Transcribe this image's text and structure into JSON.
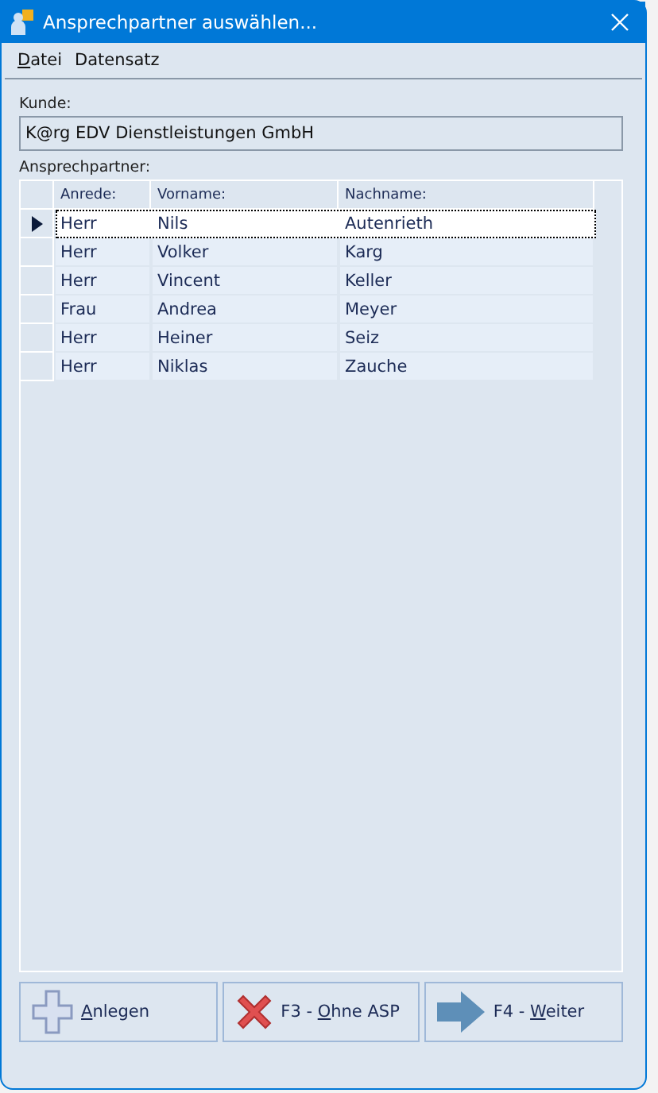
{
  "window": {
    "title": "Ansprechpartner auswählen..."
  },
  "menu": [
    {
      "key": "D",
      "rest": "atei"
    },
    {
      "rest": "Datensatz"
    }
  ],
  "customer": {
    "label": "Kunde:",
    "value": "K@rg EDV Dienstleistungen GmbH"
  },
  "contacts": {
    "label": "Ansprechpartner:",
    "columns": [
      "Anrede:",
      "Vorname:",
      "Nachname:"
    ],
    "rows": [
      {
        "cells": [
          "Herr",
          "Nils",
          "Autenrieth"
        ],
        "selected": true
      },
      {
        "cells": [
          "Herr",
          "Volker",
          "Karg"
        ],
        "selected": false
      },
      {
        "cells": [
          "Herr",
          "Vincent",
          "Keller"
        ],
        "selected": false
      },
      {
        "cells": [
          "Frau",
          "Andrea",
          "Meyer"
        ],
        "selected": false
      },
      {
        "cells": [
          "Herr",
          "Heiner",
          "Seiz"
        ],
        "selected": false
      },
      {
        "cells": [
          "Herr",
          "Niklas",
          "Zauche"
        ],
        "selected": false
      }
    ]
  },
  "buttons": [
    {
      "kind": "add",
      "key": "A",
      "after": "nlegen"
    },
    {
      "kind": "cancel",
      "before": "F3 - ",
      "key": "O",
      "after": "hne ASP"
    },
    {
      "kind": "next",
      "before": "F4 - ",
      "key": "W",
      "after": "eiter"
    }
  ]
}
